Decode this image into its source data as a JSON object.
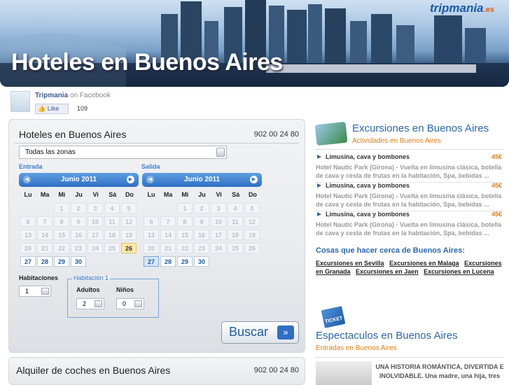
{
  "banner": {
    "title": "Hoteles en Buenos Aires",
    "logo": "tripmania",
    "logo_tld": ".es"
  },
  "facebook": {
    "page_name": "Tripmania",
    "on_text": "on Facebook",
    "like_label": "Like",
    "like_count": "109"
  },
  "hotel_search": {
    "title": "Hoteles en Buenos Aires",
    "phone": "902 00 24 80",
    "zone_value": "Todas las zonas",
    "checkin_label": "Entrada",
    "checkout_label": "Salida",
    "weekdays": [
      "Lu",
      "Ma",
      "Mi",
      "Ju",
      "Vi",
      "Sá",
      "Do"
    ],
    "calendars": [
      {
        "month": "Junio 2011"
      },
      {
        "month": "Junio 2011"
      }
    ],
    "rooms_label": "Habitaciones",
    "rooms_value": "1",
    "room_group_label": "Habitación 1",
    "adults_label": "Adultos",
    "adults_value": "2",
    "children_label": "Niños",
    "children_value": "0",
    "search_button": "Buscar"
  },
  "car_rental": {
    "title": "Alquiler de coches en Buenos Aires",
    "phone": "902 00 24 80"
  },
  "excursions": {
    "title": "Excursiones en Buenos Aires",
    "subtitle": "Actividades en Buenos Aires",
    "offers": [
      {
        "title": "Limusina, cava y bombones",
        "price": "45€",
        "desc": "Hotel Nautic Park (Girona) - Vuelta en limusina clásica, botella de cava y cesta de frutas en la habitación, Spa, bebidas ..."
      },
      {
        "title": "Limusina, cava y bombones",
        "price": "45€",
        "desc": "Hotel Nautic Park (Girona) - Vuelta en limusina clásica, botella de cava y cesta de frutas en la habitación, Spa, bebidas ..."
      },
      {
        "title": "Limusina, cava y bombones",
        "price": "45€",
        "desc": "Hotel Nautic Park (Girona) - Vuelta en limusina clásica, botella de cava y cesta de frutas en la habitación, Spa, bebidas ..."
      }
    ],
    "nearby_title": "Cosas que hacer cerca de Buenos Aires:",
    "nearby_links": [
      "Excursiones en Sevilla",
      "Excursiones en Malaga",
      "Excursiones en Granada",
      "Excursiones en Jaen",
      "Excursiones en Lucena"
    ]
  },
  "shows": {
    "ticket_label": "TICKET",
    "title": "Espectaculos en Buenos Aires",
    "subtitle": "Entradas en Buenos Aires",
    "text": "UNA HISTORIA ROMÁNTICA, DIVERTIDA E INOLVIDABLE. Una madre, una hija, tres"
  }
}
